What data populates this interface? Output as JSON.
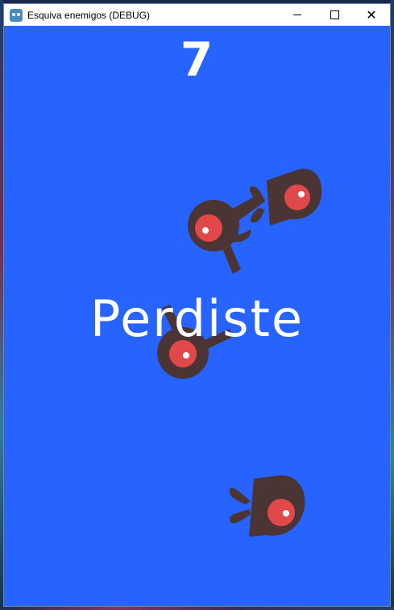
{
  "window": {
    "title": "Esquiva enemigos (DEBUG)",
    "controls": [
      "minimize",
      "maximize",
      "close"
    ],
    "close_glyph": "✕"
  },
  "game": {
    "score": "7",
    "message": "Perdiste",
    "background_color": "#2763ff",
    "enemy_body_color": "#4a3434",
    "enemy_eye_color": "#e0484a",
    "enemy_pupil_color": "#ffffff",
    "enemies": [
      {
        "name": "enemy-fish-top-right",
        "kind": "swimmer"
      },
      {
        "name": "enemy-eye-with-tail",
        "kind": "flyer"
      },
      {
        "name": "enemy-eye-center",
        "kind": "flyer"
      },
      {
        "name": "enemy-fish-bottom",
        "kind": "swimmer"
      }
    ]
  }
}
